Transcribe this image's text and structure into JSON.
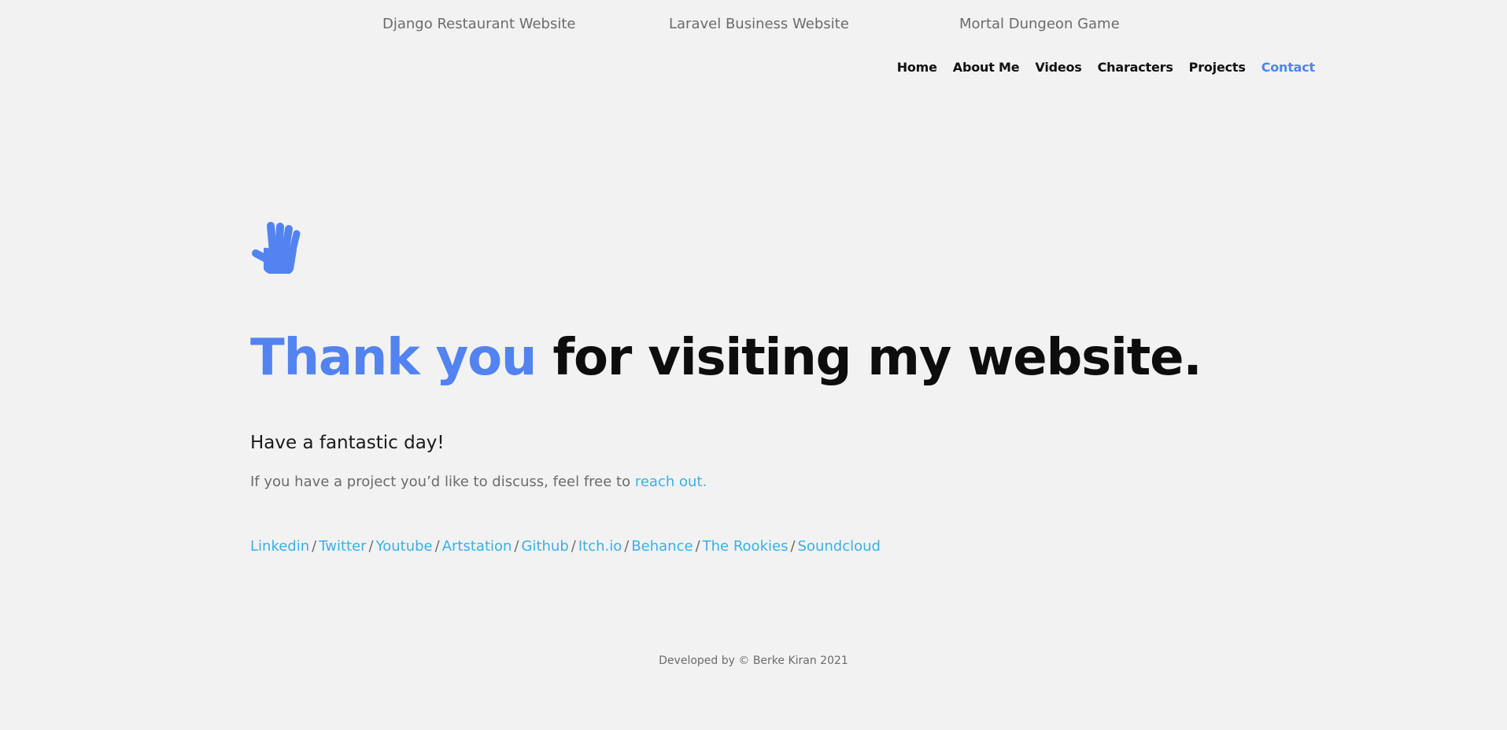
{
  "project_links": [
    {
      "label": "Django Restaurant Website"
    },
    {
      "label": "Laravel Business Website"
    },
    {
      "label": "Mortal Dungeon Game"
    }
  ],
  "nav": {
    "items": [
      {
        "label": "Home"
      },
      {
        "label": "About Me"
      },
      {
        "label": "Videos"
      },
      {
        "label": "Characters"
      },
      {
        "label": "Projects"
      },
      {
        "label": "Contact",
        "active": true
      }
    ]
  },
  "hero": {
    "icon": "waving-hand-icon",
    "headline_accent": "Thank you",
    "headline_rest": " for visiting my website.",
    "subhead": "Have a fantastic day!",
    "lead_text": "If you have a project you’d like to discuss, feel free to ",
    "lead_link": "reach out."
  },
  "socials": {
    "separator": "/",
    "links": [
      {
        "label": "Linkedin"
      },
      {
        "label": "Twitter"
      },
      {
        "label": "Youtube"
      },
      {
        "label": "Artstation"
      },
      {
        "label": "Github"
      },
      {
        "label": "Itch.io"
      },
      {
        "label": "Behance"
      },
      {
        "label": "The Rookies"
      },
      {
        "label": "Soundcloud"
      }
    ]
  },
  "footer": {
    "text": "Developed by © Berke Kiran 2021"
  },
  "colors": {
    "background": "#f2f2f2",
    "accent_blue": "#5283f0",
    "link_cyan": "#3ab0e5",
    "muted_text": "#6b6b6b",
    "heading_text": "#0d0d0d"
  }
}
